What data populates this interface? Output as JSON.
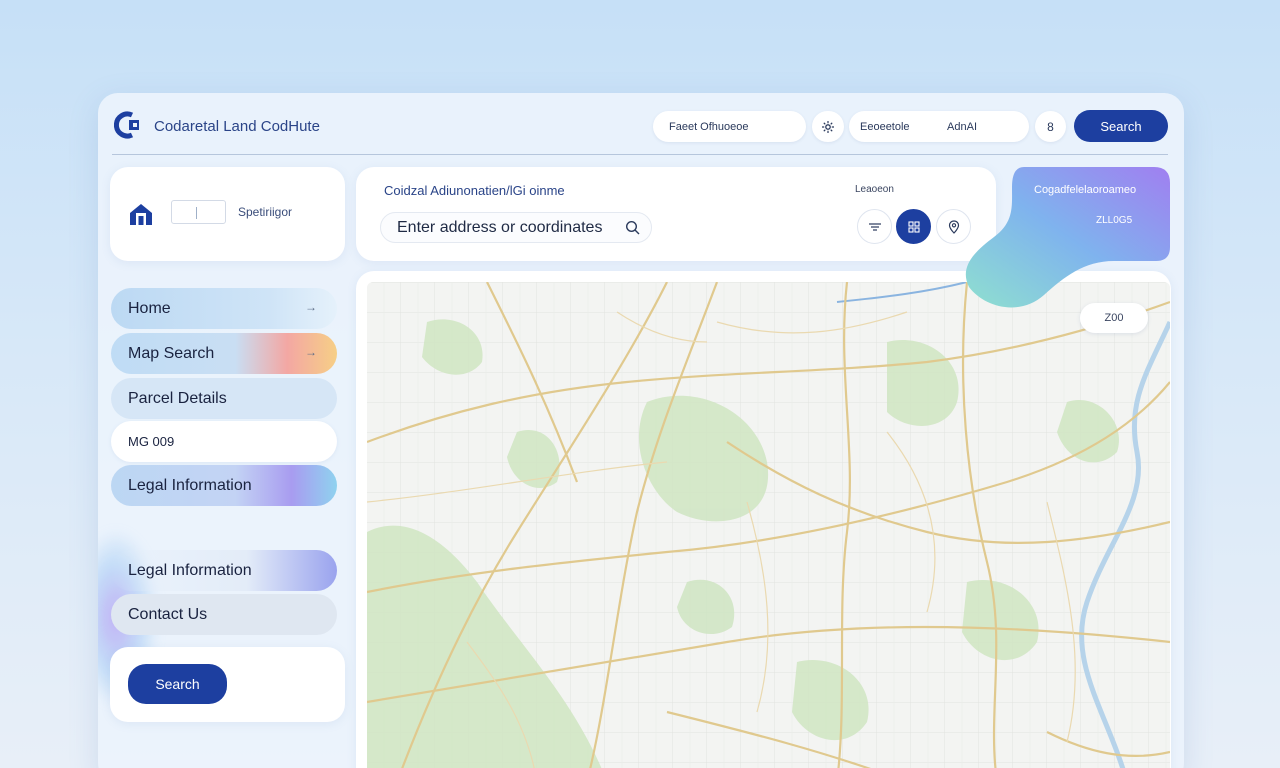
{
  "app": {
    "title": "Codaretal Land CodHute"
  },
  "header": {
    "pill_1": "Faeet Ofhuoeoe",
    "pill_2_icon": "settings-icon",
    "pill_3_left": "Eeoeetole",
    "pill_3_right": "AdnAI",
    "pill_4": "8",
    "search_label": "Search"
  },
  "sidebar": {
    "top_label": "Spetiriigor",
    "items": [
      {
        "label": "Home",
        "arrow": "→"
      },
      {
        "label": "Map Search",
        "arrow": "→"
      },
      {
        "label": "Parcel Details"
      },
      {
        "label": "MG 009"
      },
      {
        "label": "Legal Information"
      },
      {
        "label": "Legal Information"
      },
      {
        "label": "Contact Us"
      }
    ],
    "search_label": "Search"
  },
  "search_card": {
    "title": "Coidzal Adiunonatien/lGi oinme",
    "meta": "Leaoeon",
    "placeholder": "Enter address or coordinates",
    "icons": [
      "filter-icon",
      "grid-icon",
      "pin-icon"
    ]
  },
  "gradient_card": {
    "line_1": "Cogadfelelaoroameo",
    "line_2": "ZLL0G5"
  },
  "map": {
    "badge": "Z00"
  },
  "colors": {
    "primary": "#1d3fa0",
    "background": "#c6e0f7",
    "panel": "#ecf3fc"
  }
}
